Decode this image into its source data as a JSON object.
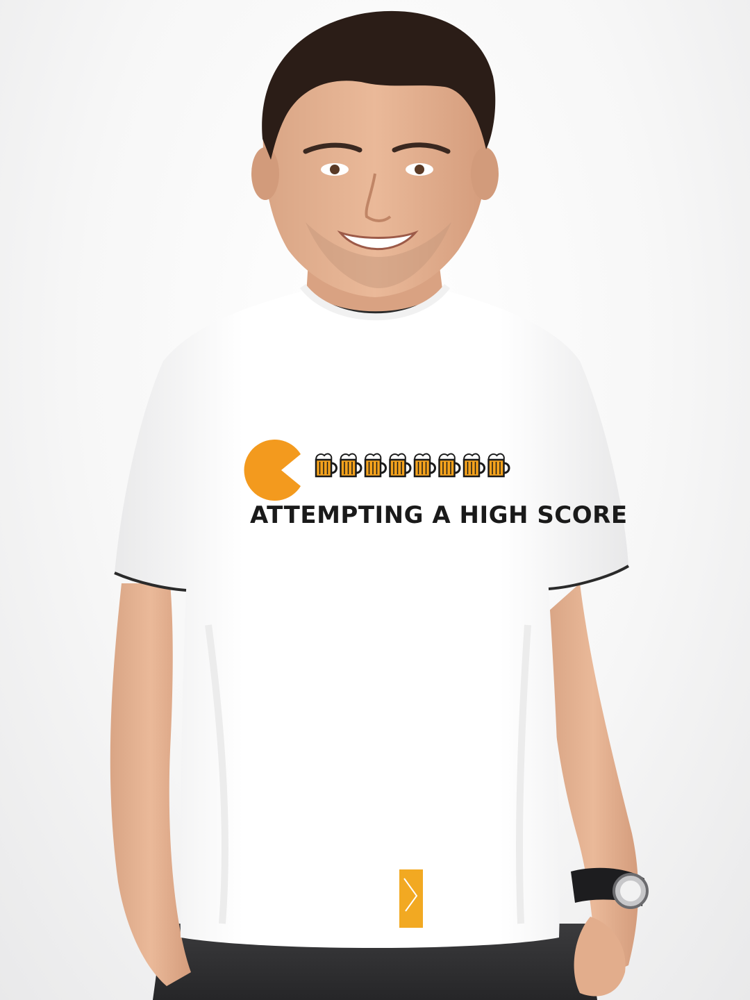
{
  "photo": {
    "subject": "man-wearing-white-graphic-tshirt",
    "background_color": "#f3f3f3",
    "tshirt_color": "#ffffff"
  },
  "print": {
    "text": "ATTEMPTING A HIGH SCORE",
    "text_color": "#1a1a1a",
    "pacman_color": "#f39a1e",
    "beer_color": "#f4a21c",
    "beer_mug_count": 8
  }
}
